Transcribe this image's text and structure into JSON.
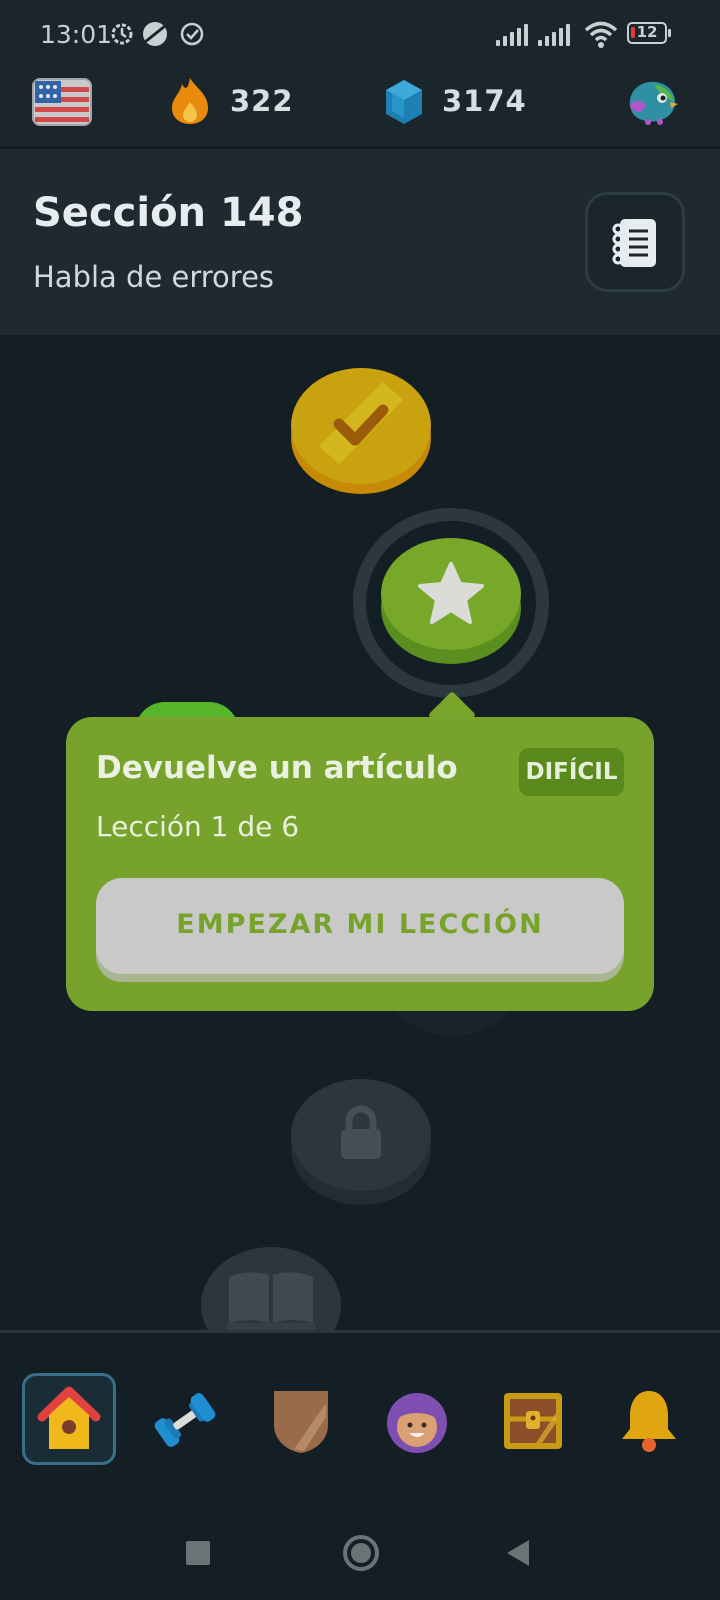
{
  "status_bar": {
    "time": "13:01",
    "battery": "12"
  },
  "stats": {
    "language": "English (US flag)",
    "streak": "322",
    "gems": "3174"
  },
  "section": {
    "title": "Sección 148",
    "subtitle": "Habla de errores"
  },
  "popup": {
    "title": "Devuelve un artículo",
    "difficulty": "DIFÍCIL",
    "progress": "Lección 1 de 6",
    "button": "EMPEZAR MI LECCIÓN"
  },
  "path_nodes": [
    {
      "state": "completed",
      "icon": "check-icon"
    },
    {
      "state": "current",
      "icon": "star-icon"
    },
    {
      "state": "locked",
      "icon": "lock-icon"
    },
    {
      "state": "locked",
      "icon": "lock-icon"
    },
    {
      "state": "locked",
      "icon": "book-icon"
    }
  ],
  "bottom_nav": [
    {
      "name": "home",
      "icon": "birdhouse-icon",
      "selected": true
    },
    {
      "name": "practice",
      "icon": "dumbbell-icon",
      "selected": false
    },
    {
      "name": "leagues",
      "icon": "shield-icon",
      "selected": false
    },
    {
      "name": "profile",
      "icon": "avatar-icon",
      "selected": false
    },
    {
      "name": "shop",
      "icon": "treasure-chest-icon",
      "selected": false
    },
    {
      "name": "notifications",
      "icon": "bell-icon",
      "selected": false
    }
  ],
  "colors": {
    "background": "#131f24",
    "accent_green": "#77a22b",
    "gold": "#d4a310",
    "gem_blue": "#2196c9",
    "streak_orange": "#e88a0c"
  }
}
